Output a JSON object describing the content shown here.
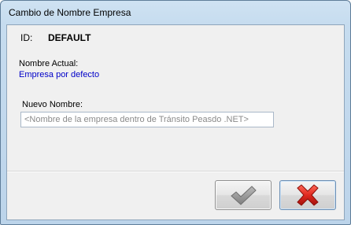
{
  "window": {
    "title": "Cambio de Nombre Empresa"
  },
  "form": {
    "id_label": "ID:",
    "id_value": "DEFAULT",
    "current_name_label": "Nombre Actual:",
    "current_name_value": "Empresa por defecto",
    "new_name_label": "Nuevo Nombre:",
    "new_name_value": "",
    "new_name_placeholder": "<Nombre de la empresa dentro de Tránsito Peasdo .NET>"
  },
  "buttons": {
    "ok_icon": "checkmark-icon",
    "cancel_icon": "red-x-icon"
  },
  "colors": {
    "current_name_text": "#0000c8",
    "cancel_red": "#d8261d",
    "check_gray": "#8c8c8c"
  }
}
